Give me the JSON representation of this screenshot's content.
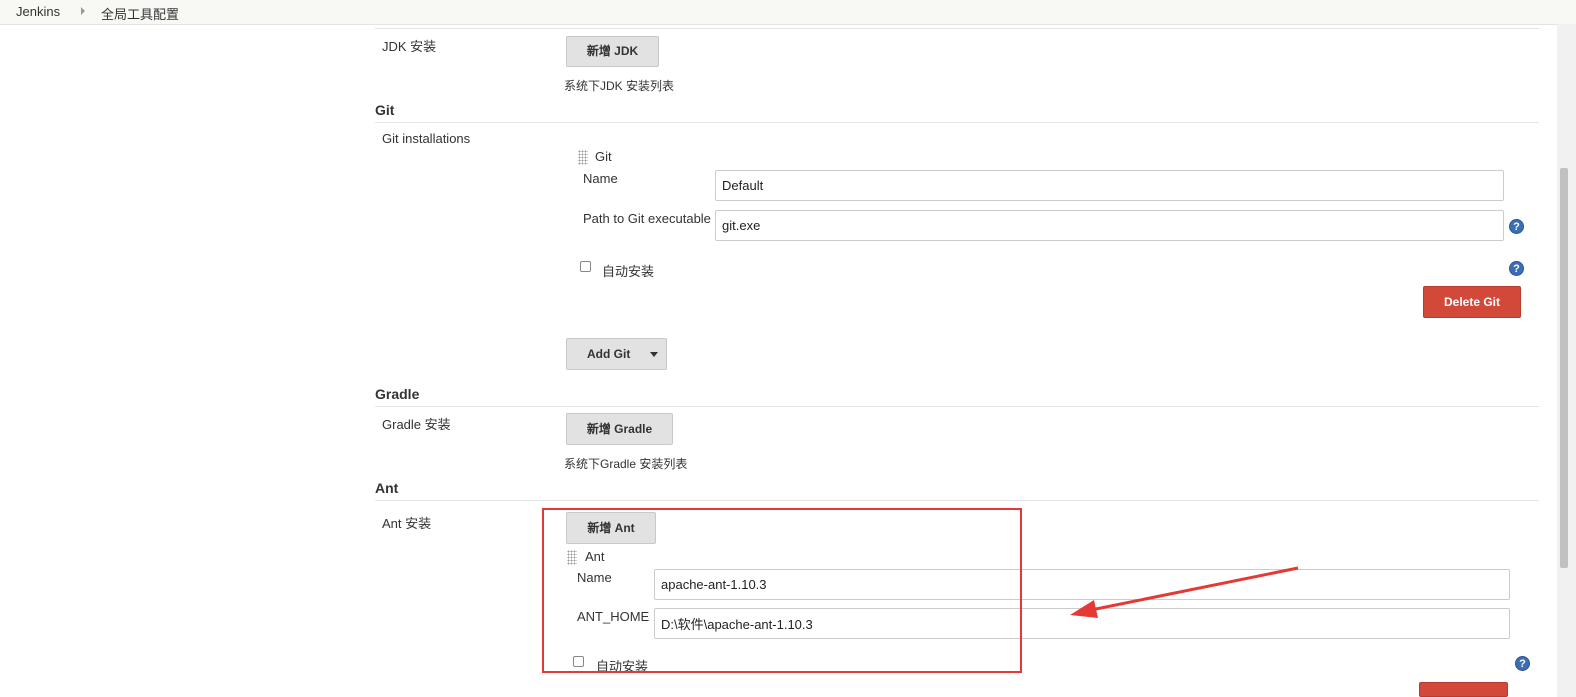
{
  "breadcrumb": {
    "items": [
      "Jenkins",
      "全局工具配置"
    ]
  },
  "jdk": {
    "label": "JDK 安装",
    "add_button": "新增 JDK",
    "hint": "系统下JDK 安装列表"
  },
  "git": {
    "section_title": "Git",
    "label": "Git installations",
    "entry_title": "Git",
    "name_label": "Name",
    "name_value": "Default",
    "path_label": "Path to Git executable",
    "path_value": "git.exe",
    "auto_install_label": "自动安装",
    "delete_button": "Delete Git",
    "add_button": "Add Git"
  },
  "gradle": {
    "section_title": "Gradle",
    "label": "Gradle 安装",
    "add_button": "新增 Gradle",
    "hint": "系统下Gradle 安装列表"
  },
  "ant": {
    "section_title": "Ant",
    "label": "Ant 安装",
    "add_button": "新增 Ant",
    "entry_title": "Ant",
    "name_label": "Name",
    "name_value": "apache-ant-1.10.3",
    "home_label": "ANT_HOME",
    "home_value": "D:\\软件\\apache-ant-1.10.3",
    "auto_install_label": "自动安装"
  },
  "colors": {
    "annotation": "#e53935",
    "delete_button": "#d24939",
    "help_icon": "#3c6eb4"
  },
  "icons": [
    "chevron-right-icon",
    "drag-handle-icon",
    "help-icon",
    "dropdown-arrow-icon"
  ]
}
